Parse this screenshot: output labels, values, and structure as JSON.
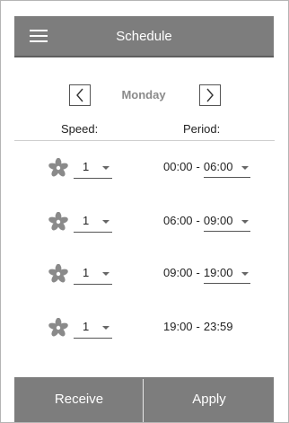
{
  "header": {
    "title": "Schedule",
    "menu_icon": "hamburger-menu-icon"
  },
  "day_nav": {
    "day": "Monday",
    "prev_icon": "chevron-left-icon",
    "next_icon": "chevron-right-icon"
  },
  "columns": {
    "speed": "Speed:",
    "period": "Period:"
  },
  "rows": [
    {
      "speed": "1",
      "start": "00:00",
      "end": "06:00",
      "end_editable": true
    },
    {
      "speed": "1",
      "start": "06:00",
      "end": "09:00",
      "end_editable": true
    },
    {
      "speed": "1",
      "start": "09:00",
      "end": "19:00",
      "end_editable": true
    },
    {
      "speed": "1",
      "start": "19:00",
      "end": "23:59",
      "end_editable": false
    }
  ],
  "period_separator": "-",
  "footer": {
    "receive": "Receive",
    "apply": "Apply"
  },
  "colors": {
    "bar": "#7d7d7d",
    "icon": "#8a8a8a"
  }
}
